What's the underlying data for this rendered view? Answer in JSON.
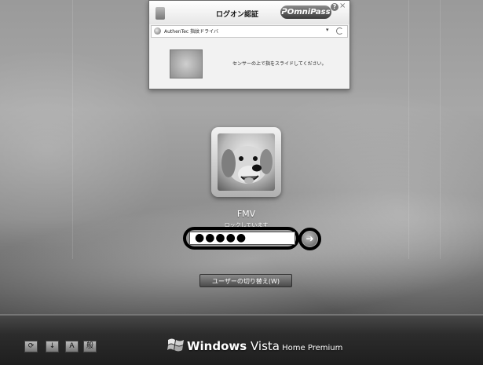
{
  "auth_dialog": {
    "title": "ログオン認証",
    "brand_logo": "ᕈOmniPass",
    "help": "?",
    "close": "×",
    "device_name": "AuthenTec 指紋ドライバ",
    "dropdown_glyph": "▾",
    "sensor_message": "センサーの上で指をスライドしてください。"
  },
  "user": {
    "name": "FMV",
    "status": "ロックしています",
    "password_mask": "●●●●●",
    "submit_glyph": "➔"
  },
  "switch_user_label": "ユーザーの切り替え(W)",
  "ease_buttons": [
    "⟳",
    "↓",
    "A",
    "般"
  ],
  "brand": {
    "windows": "Windows",
    "vista": " Vista",
    "edition": " Home Premium"
  }
}
